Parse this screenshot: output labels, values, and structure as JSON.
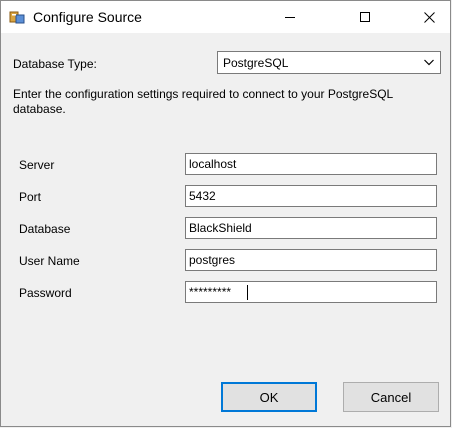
{
  "window": {
    "title": "Configure Source",
    "icons": {
      "app": "database-app-icon",
      "minimize": "minimize-icon",
      "maximize": "maximize-icon",
      "close": "close-icon"
    }
  },
  "database_type": {
    "label": "Database Type:",
    "selected": "PostgreSQL"
  },
  "description": "Enter the configuration settings required to connect to your PostgreSQL database.",
  "fields": {
    "server": {
      "label": "Server",
      "value": "localhost"
    },
    "port": {
      "label": "Port",
      "value": "5432"
    },
    "database": {
      "label": "Database",
      "value": "BlackShield"
    },
    "username": {
      "label": "User Name",
      "value": "postgres"
    },
    "password": {
      "label": "Password",
      "value": "*********"
    }
  },
  "buttons": {
    "ok": "OK",
    "cancel": "Cancel"
  },
  "colors": {
    "focus_border": "#0078d7",
    "dialog_bg": "#f0f0f0"
  }
}
